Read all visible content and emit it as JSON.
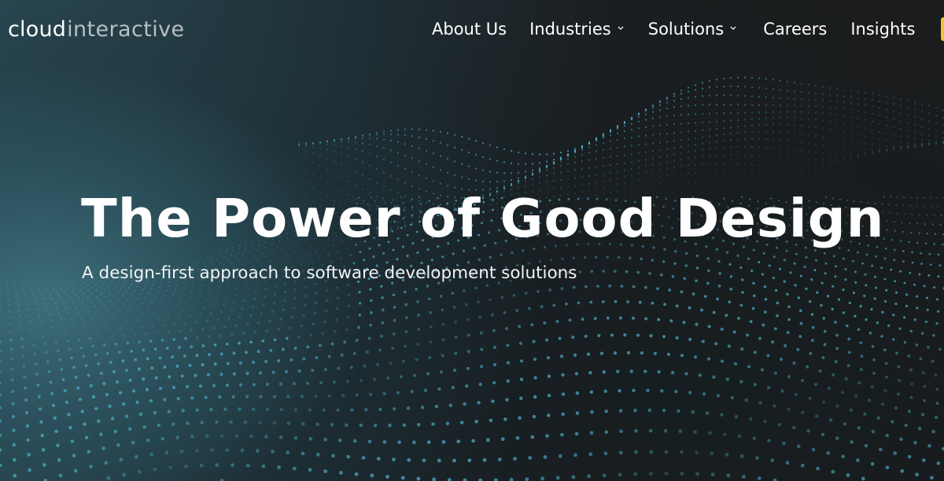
{
  "header": {
    "logo": {
      "part1": "cloud",
      "part2": "interactive"
    },
    "nav": [
      {
        "label": "About Us",
        "has_dropdown": false
      },
      {
        "label": "Industries",
        "has_dropdown": true
      },
      {
        "label": "Solutions",
        "has_dropdown": true
      },
      {
        "label": "Careers",
        "has_dropdown": false
      },
      {
        "label": "Insights",
        "has_dropdown": false
      }
    ],
    "dropdown_icon": "chevron-down-icon"
  },
  "hero": {
    "title": "The Power of Good Design",
    "subtitle": "A design-first approach to software development solutions"
  },
  "colors": {
    "background_dark": "#1b1d1f",
    "teal_glow": "#3e707c",
    "dot_color": "#4fb3cf",
    "cta_accent": "#f2c230",
    "text": "#ffffff"
  }
}
